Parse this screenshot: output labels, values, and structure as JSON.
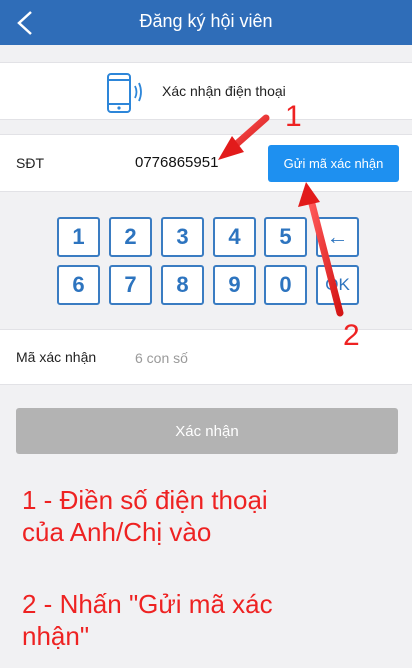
{
  "header": {
    "title": "Đăng ký hội viên",
    "back_icon": "chevron-left-icon"
  },
  "verify_section": {
    "icon": "smartphone-icon",
    "label": "Xác nhận điện thoại"
  },
  "phone_row": {
    "label": "SĐT",
    "value": "0776865951",
    "send_button": "Gửi mã xác nhận"
  },
  "keypad": {
    "keys": [
      "1",
      "2",
      "3",
      "4",
      "5",
      "←",
      "6",
      "7",
      "8",
      "9",
      "0",
      "OK"
    ]
  },
  "code_row": {
    "label": "Mã xác nhận",
    "placeholder": "6 con số"
  },
  "confirm_button": "Xác nhận",
  "annotations": {
    "step1_number": "1",
    "step2_number": "2",
    "note1_line1": "1 - Điền số điện thoại",
    "note1_line2": "của Anh/Chị vào",
    "note2_line1": "2 - Nhấn \"Gửi mã xác",
    "note2_line2": "nhận\""
  },
  "colors": {
    "header": "#2f6db8",
    "accent": "#1e90f0",
    "annotation": "#ee2222",
    "disabled": "#b3b3b3"
  }
}
